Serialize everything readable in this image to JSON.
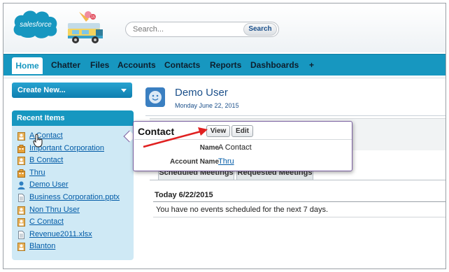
{
  "header": {
    "logo_text": "salesforce",
    "search": {
      "placeholder": "Search...",
      "button_label": "Search"
    }
  },
  "tabs": [
    {
      "label": "Home",
      "active": true
    },
    {
      "label": "Chatter"
    },
    {
      "label": "Files"
    },
    {
      "label": "Accounts"
    },
    {
      "label": "Contacts"
    },
    {
      "label": "Reports"
    },
    {
      "label": "Dashboards"
    },
    {
      "label": "+"
    }
  ],
  "sidebar": {
    "create_new_label": "Create New...",
    "recent_title": "Recent Items",
    "recent_items": [
      {
        "label": "A Contact",
        "icon": "contact-icon"
      },
      {
        "label": "Important Corporation",
        "icon": "account-icon"
      },
      {
        "label": "B Contact",
        "icon": "contact-icon"
      },
      {
        "label": "Thru",
        "icon": "account-icon"
      },
      {
        "label": "Demo User",
        "icon": "user-icon"
      },
      {
        "label": "Business Corporation.pptx",
        "icon": "document-icon"
      },
      {
        "label": "Non Thru User",
        "icon": "contact-icon"
      },
      {
        "label": "C Contact",
        "icon": "contact-icon"
      },
      {
        "label": "Revenue2011.xlsx",
        "icon": "document-icon"
      },
      {
        "label": "Blanton",
        "icon": "contact-icon"
      }
    ]
  },
  "main": {
    "user_name": "Demo User",
    "date": "Monday June 22, 2015",
    "tab_scheduled": "Scheduled Meetings",
    "tab_requested": "Requested Meetings",
    "today_label": "Today 6/22/2015",
    "no_events_text": "You have no events scheduled for the next 7 days."
  },
  "popup": {
    "title": "Contact",
    "view_label": "View",
    "edit_label": "Edit",
    "fields": [
      {
        "label": "Name",
        "value": "A Contact",
        "is_link": false
      },
      {
        "label": "Account Name",
        "value": "Thru",
        "is_link": true
      }
    ]
  },
  "colors": {
    "brand_blue": "#1797c0",
    "link": "#015ba7",
    "arrow": "#e02020",
    "popup_border": "#7a5fa0"
  }
}
